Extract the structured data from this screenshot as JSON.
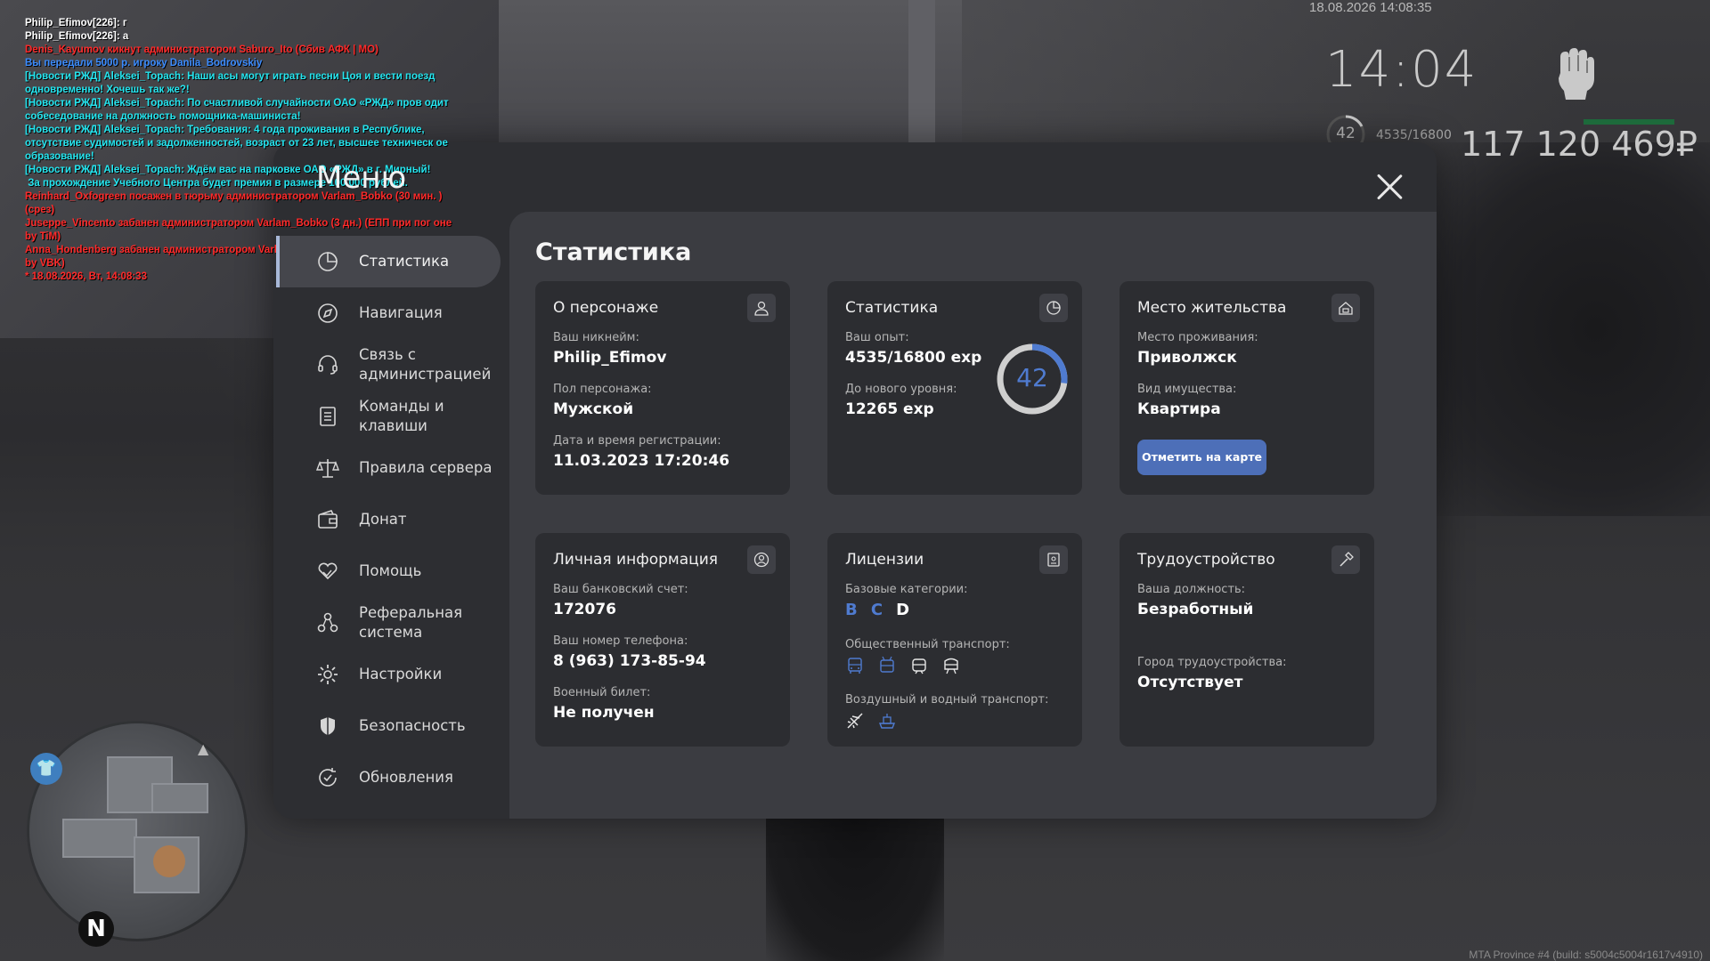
{
  "chat": [
    {
      "text": "Philip_Efimov[226]: г",
      "color": "white"
    },
    {
      "text": "Philip_Efimov[226]: а",
      "color": "white"
    },
    {
      "text": "Denis_Kayumov кикнут администратором Saburo_Ito (Сбив АФК | МО)",
      "color": "red"
    },
    {
      "text": "Вы передали 5000 р. игроку Danila_Bodrovskiy",
      "color": "blue"
    },
    {
      "text": "[Новости РЖД] Aleksei_Topach: Наши асы могут играть песни Цоя и вести поезд одновременно! Хочешь так же?!",
      "color": "cyan"
    },
    {
      "text": "[Новости РЖД] Aleksei_Topach: По счастливой случайности ОАО «РЖД» пров одит собеседование на должность помощника-машиниста!",
      "color": "cyan"
    },
    {
      "text": "[Новости РЖД] Aleksei_Topach: Требования: 4 года проживания в Республике, отсутствие судимостей и задолженностей, возраст от 23 лет, высшее техническ ое образование!",
      "color": "cyan"
    },
    {
      "text": "[Новости РЖД] Aleksei_Topach: Ждём вас на парковке ОАО «РЖД» в г. Мирный!",
      "color": "cyan"
    },
    {
      "text": " За прохождение Учебного Центра будет премия в размере 100.000 рублей.",
      "color": "cyan"
    },
    {
      "text": "Reinhard_Oxfogreen посажен в тюрьму администратором Varlam_Bobko (30 мин. ) (срез)",
      "color": "red"
    },
    {
      "text": "Juseppe_Vincento забанен администратором Varlam_Bobko (3 дн.) (ЕПП при пог оне by TiM)",
      "color": "red"
    },
    {
      "text": "Anna_Hondenberg забанен администратором Varlam_Bobko (3 дн.) (бх при пога не by VBK)",
      "color": "red"
    },
    {
      "text": "* 18.08.2026, Вт, 14:08:33",
      "color": "red"
    }
  ],
  "hud": {
    "date": "18.08.2026 14:08:35",
    "time": "14:04",
    "level": "42",
    "exp": "4535/16800",
    "money": "117 120 469₽",
    "build": "MTA Province #4 (build: s5004c5004r1617v4910)"
  },
  "minimap": {
    "north": "N"
  },
  "menu": {
    "title": "Меню",
    "sidebar": [
      {
        "label": "Статистика",
        "icon": "pie-chart-icon",
        "active": true
      },
      {
        "label": "Навигация",
        "icon": "compass-icon"
      },
      {
        "label": "Связь с администрацией",
        "icon": "headset-icon"
      },
      {
        "label": "Команды и клавиши",
        "icon": "document-list-icon"
      },
      {
        "label": "Правила сервера",
        "icon": "scales-icon"
      },
      {
        "label": "Донат",
        "icon": "wallet-icon"
      },
      {
        "label": "Помощь",
        "icon": "heart-hands-icon"
      },
      {
        "label": "Реферальная система",
        "icon": "people-network-icon"
      },
      {
        "label": "Настройки",
        "icon": "gear-icon"
      },
      {
        "label": "Безопасность",
        "icon": "shield-icon"
      },
      {
        "label": "Обновления",
        "icon": "refresh-check-icon"
      }
    ],
    "content_title": "Статистика",
    "cards": {
      "character": {
        "title": "О персонаже",
        "icon": "user-icon",
        "nickname_label": "Ваш никнейм:",
        "nickname": "Philip_Efimov",
        "gender_label": "Пол персонажа:",
        "gender": "Мужской",
        "reg_label": "Дата и время регистрации:",
        "reg": "11.03.2023 17:20:46"
      },
      "stats": {
        "title": "Статистика",
        "icon": "pie-chart-icon",
        "exp_label": "Ваш опыт:",
        "exp": "4535/16800 exp",
        "next_label": "До нового уровня:",
        "next": "12265 exp",
        "level": "42",
        "progress": 0.27
      },
      "residence": {
        "title": "Место жительства",
        "icon": "house-icon",
        "place_label": "Место проживания:",
        "place": "Приволжск",
        "property_label": "Вид имущества:",
        "property": "Квартира",
        "button": "Отметить на карте"
      },
      "personal": {
        "title": "Личная информация",
        "icon": "user-circle-icon",
        "bank_label": "Ваш банковский счет:",
        "bank": "172076",
        "phone_label": "Ваш номер телефона:",
        "phone": "8 (963) 173-85-94",
        "military_label": "Военный билет:",
        "military": "Не получен"
      },
      "licenses": {
        "title": "Лицензии",
        "icon": "license-badge-icon",
        "base_label": "Базовые категории:",
        "categories": [
          {
            "name": "B",
            "active": true
          },
          {
            "name": "C",
            "active": true
          },
          {
            "name": "D",
            "active": false
          }
        ],
        "public_label": "Общественный транспорт:",
        "public_icons": [
          "bus-icon",
          "trolleybus-icon",
          "tram-icon",
          "train-icon"
        ],
        "air_label": "Воздушный и водный транспорт:",
        "air_icons": [
          "airplane-icon",
          "ship-icon"
        ]
      },
      "job": {
        "title": "Трудоустройство",
        "icon": "hammer-icon",
        "position_label": "Ваша должность:",
        "position": "Безработный",
        "city_label": "Город трудоустройства:",
        "city": "Отсутствует"
      }
    }
  }
}
